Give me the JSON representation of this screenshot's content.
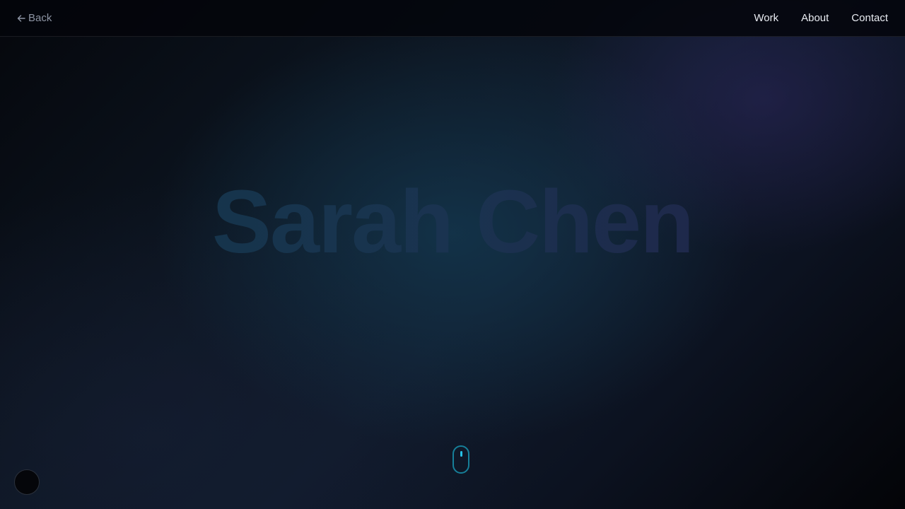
{
  "header": {
    "back_label": "Back",
    "nav": [
      {
        "label": "Work"
      },
      {
        "label": "About"
      },
      {
        "label": "Contact"
      }
    ]
  },
  "hero": {
    "name": "Sarah Chen"
  },
  "icons": {
    "back": "arrow-left-icon",
    "scroll": "mouse-scroll-icon"
  },
  "colors": {
    "accent": "#27c1e6",
    "scroll_outline": "#167f99",
    "nav_text": "#e9ecf2",
    "back_text": "#8d94a3",
    "hero_gradient": [
      "#123648",
      "#1a3350",
      "#221f46"
    ]
  }
}
